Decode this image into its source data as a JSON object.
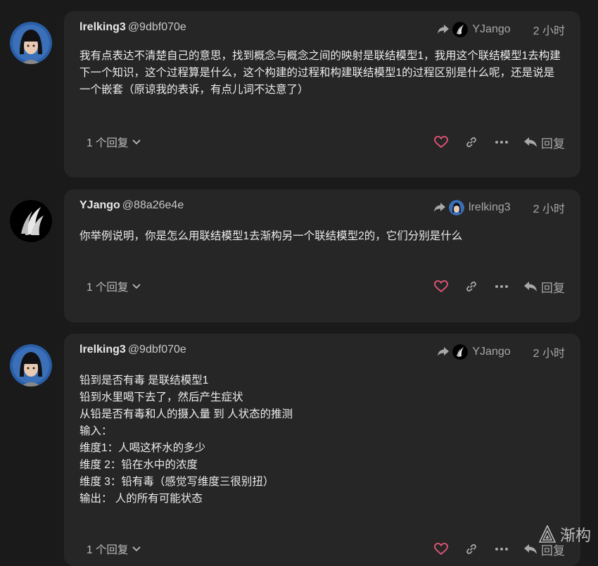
{
  "posts": [
    {
      "author": "lrelking3",
      "handle": "@9dbf070e",
      "reply_to": "YJango",
      "time": "2 小时",
      "body": [
        "我有点表达不清楚自己的意思，找到概念与概念之间的映射是联结模型1，我用这个联结模型1去构建下一个知识，这个过程算是什么，这个构建的过程和构建联结模型1的过程区别是什么呢，还是说是一个嵌套（原谅我的表诉，有点儿词不达意了）"
      ],
      "replies": "1 个回复",
      "reply_label": "回复"
    },
    {
      "author": "YJango",
      "handle": "@88a26e4e",
      "reply_to": "lrelking3",
      "time": "2 小时",
      "body": [
        "你举例说明，你是怎么用联结模型1去渐构另一个联结模型2的，它们分别是什么"
      ],
      "replies": "1 个回复",
      "reply_label": "回复"
    },
    {
      "author": "lrelking3",
      "handle": "@9dbf070e",
      "reply_to": "YJango",
      "time": "2 小时",
      "body": [
        "铅到是否有毒 是联结模型1",
        "铅到水里喝下去了，然后产生症状",
        "从铅是否有毒和人的摄入量 到 人状态的推测",
        "输入：",
        "维度1：人喝这杯水的多少",
        "维度 2：铅在水中的浓度",
        "维度 3：铅有毒（感觉写维度三很别扭）",
        "输出： 人的所有可能状态"
      ],
      "replies": "1 个回复",
      "reply_label": "回复"
    }
  ],
  "watermark": "渐构",
  "colors": {
    "background": "#1a1a1a",
    "card": "#262626",
    "like": "#e8557a"
  }
}
